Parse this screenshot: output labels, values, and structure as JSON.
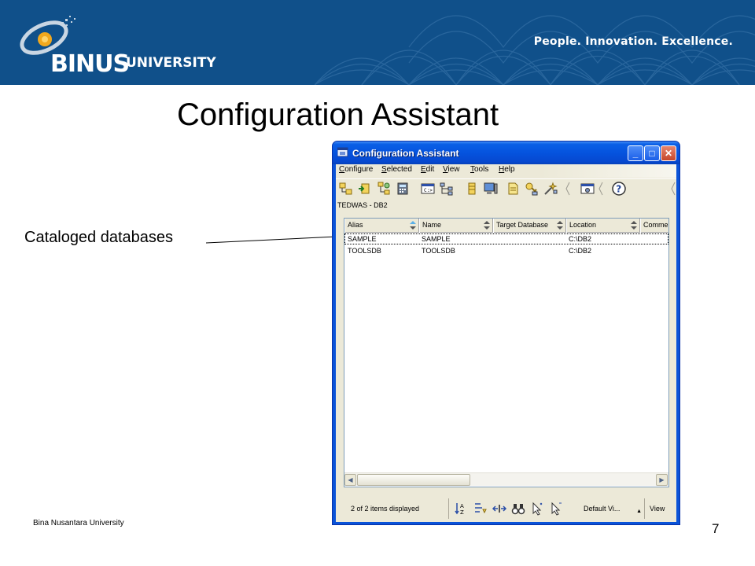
{
  "slide": {
    "university_name": "BINUS",
    "university_word": "UNIVERSITY",
    "tagline": "People. Innovation. Excellence.",
    "title": "Configuration Assistant",
    "callout": "Cataloged databases",
    "footer": "Bina Nusantara University",
    "page_number": "7"
  },
  "window": {
    "title": "Configuration Assistant",
    "controls": {
      "minimize": "_",
      "maximize": "□",
      "close": "✕"
    },
    "menu": [
      {
        "label": "Configure",
        "mnemonic": "C",
        "rest": "onfigure"
      },
      {
        "label": "Selected",
        "mnemonic": "S",
        "rest": "elected"
      },
      {
        "label": "Edit",
        "mnemonic": "E",
        "rest": "dit"
      },
      {
        "label": "View",
        "mnemonic": "V",
        "rest": "iew"
      },
      {
        "label": "Tools",
        "mnemonic": "T",
        "rest": "ools"
      },
      {
        "label": "Help",
        "mnemonic": "H",
        "rest": "elp"
      }
    ],
    "toolbar_icons": [
      "add-database-icon",
      "catalog-icon",
      "network-discover-icon",
      "calculator-icon",
      "command-window-icon",
      "network-tree-icon",
      "database-cylinder-icon",
      "server-monitor-icon",
      "note-icon",
      "key-icon",
      "connect-wizard-icon",
      "settings-window-icon",
      "help-icon"
    ],
    "context": "TEDWAS - DB2",
    "table": {
      "columns": [
        "Alias",
        "Name",
        "Target Database",
        "Location",
        "Comme"
      ],
      "rows": [
        [
          "SAMPLE",
          "SAMPLE",
          "",
          "C:\\DB2",
          ""
        ],
        [
          "TOOLSDB",
          "TOOLSDB",
          "",
          "C:\\DB2",
          ""
        ]
      ]
    },
    "status": {
      "items_text": "2 of 2 items displayed",
      "view_combo": "Default Vi...",
      "view_button": "View"
    },
    "colors": {
      "title_bar": "#0553de",
      "window_bg": "#ece9d8",
      "banner": "#10508a"
    }
  }
}
